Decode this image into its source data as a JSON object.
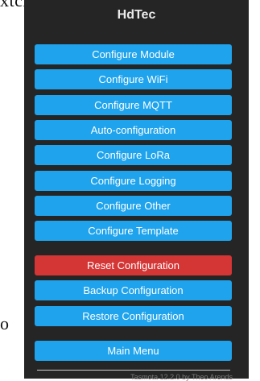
{
  "background": {
    "top_text": "xtcrcu",
    "side_text": "o"
  },
  "app": {
    "title": "HdTec"
  },
  "menu": {
    "buttons": [
      {
        "label": "Configure Module"
      },
      {
        "label": "Configure WiFi"
      },
      {
        "label": "Configure MQTT"
      },
      {
        "label": "Auto-configuration"
      },
      {
        "label": "Configure LoRa"
      },
      {
        "label": "Configure Logging"
      },
      {
        "label": "Configure Other"
      },
      {
        "label": "Configure Template"
      },
      {
        "label": "Reset Configuration"
      },
      {
        "label": "Backup Configuration"
      },
      {
        "label": "Restore Configuration"
      },
      {
        "label": "Main Menu"
      }
    ]
  },
  "footer": {
    "text": "Tasmota 12.2.0 by Theo Arends"
  },
  "colors": {
    "panel": "#252525",
    "button": "#1fa3ec",
    "danger": "#d43535",
    "title": "#eaeaea"
  }
}
